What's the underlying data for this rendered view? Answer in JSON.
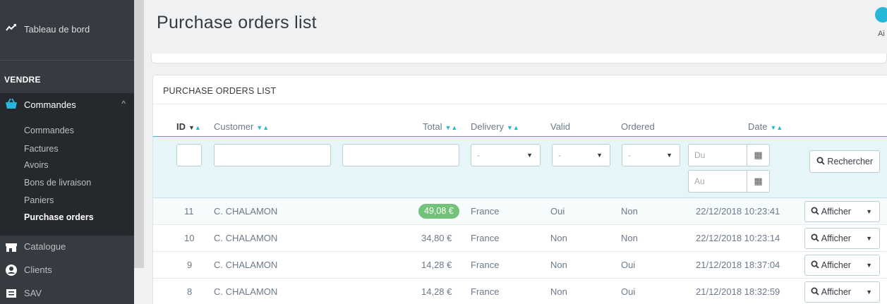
{
  "sidebar": {
    "dashboard": "Tableau de bord",
    "section": "VENDRE",
    "orders_menu": "Commandes",
    "sub_items": [
      "Commandes",
      "Factures",
      "Avoirs",
      "Bons de livraison",
      "Paniers",
      "Purchase orders"
    ],
    "active_sub": "Purchase orders",
    "main_items": [
      "Catalogue",
      "Clients",
      "SAV"
    ]
  },
  "header": {
    "title": "Purchase orders list",
    "help_label": "Ai"
  },
  "panel": {
    "heading": "PURCHASE ORDERS LIST",
    "columns": {
      "id": "ID",
      "customer": "Customer",
      "total": "Total",
      "delivery": "Delivery",
      "valid": "Valid",
      "ordered": "Ordered",
      "date": "Date"
    },
    "filters": {
      "select_default": "-",
      "date_from": "Du",
      "date_to": "Au",
      "search_button": "Rechercher"
    },
    "rows": [
      {
        "id": "11",
        "customer": "C. CHALAMON",
        "total": "49,08 €",
        "delivery": "France",
        "valid": "Oui",
        "ordered": "Non",
        "date": "22/12/2018 10:23:41",
        "action": "Afficher"
      },
      {
        "id": "10",
        "customer": "C. CHALAMON",
        "total": "34,80 €",
        "delivery": "France",
        "valid": "Non",
        "ordered": "Non",
        "date": "22/12/2018 10:23:14",
        "action": "Afficher"
      },
      {
        "id": "9",
        "customer": "C. CHALAMON",
        "total": "14,28 €",
        "delivery": "France",
        "valid": "Non",
        "ordered": "Oui",
        "date": "21/12/2018 18:37:04",
        "action": "Afficher"
      },
      {
        "id": "8",
        "customer": "C. CHALAMON",
        "total": "14,28 €",
        "delivery": "France",
        "valid": "Non",
        "ordered": "Oui",
        "date": "21/12/2018 18:32:59",
        "action": "Afficher"
      }
    ]
  },
  "colors": {
    "accent": "#25b9d7",
    "sidebar": "#363a41",
    "badge": "#72c279"
  }
}
